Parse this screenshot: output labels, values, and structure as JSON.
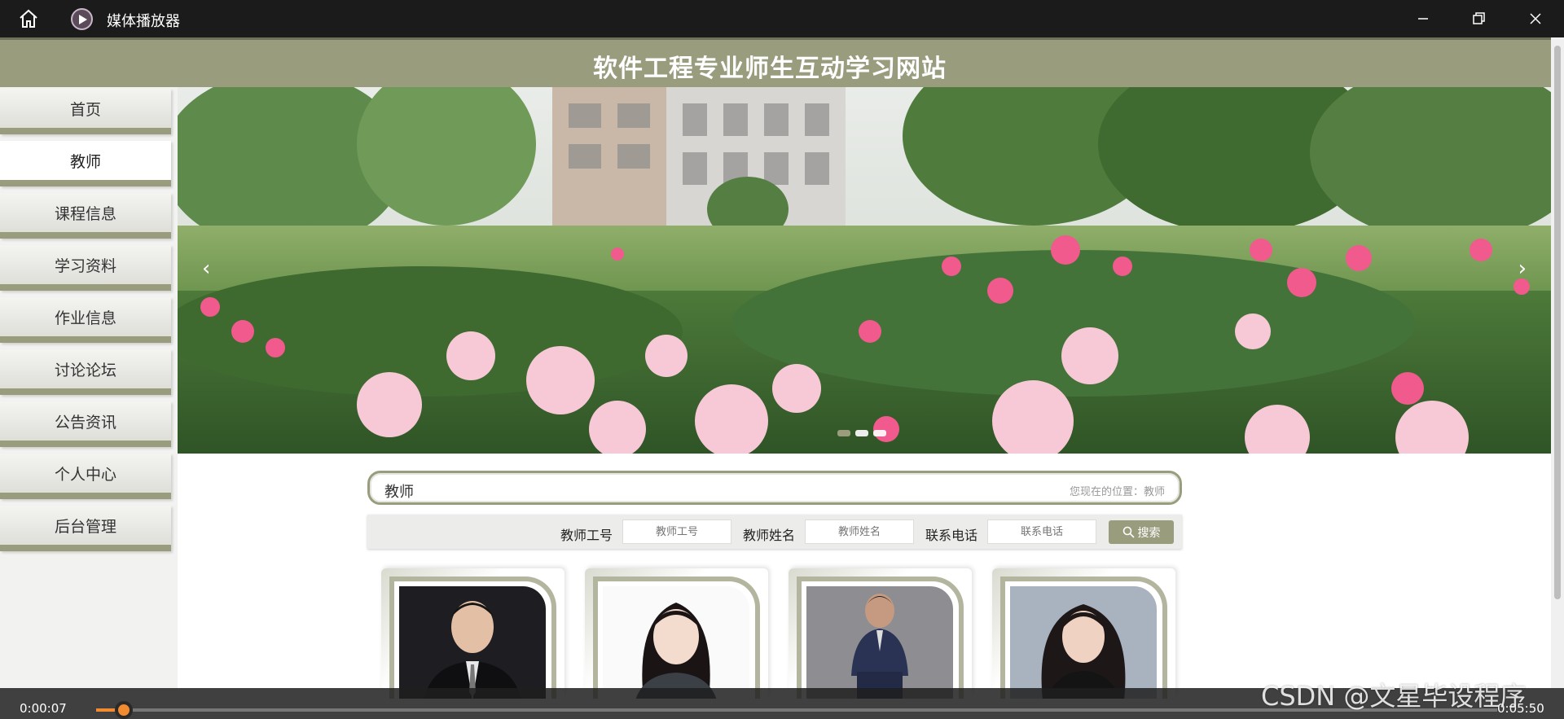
{
  "player": {
    "title": "媒体播放器",
    "current_time": "0:00:07",
    "total_time": "0:05:50",
    "progress": 0.02
  },
  "site": {
    "title": "软件工程专业师生互动学习网站"
  },
  "sidebar": {
    "items": [
      {
        "label": "首页"
      },
      {
        "label": "教师"
      },
      {
        "label": "课程信息"
      },
      {
        "label": "学习资料"
      },
      {
        "label": "作业信息"
      },
      {
        "label": "讨论论坛"
      },
      {
        "label": "公告资讯"
      },
      {
        "label": "个人中心"
      },
      {
        "label": "后台管理"
      }
    ],
    "active_index": 1
  },
  "banner": {
    "arrow_left": "‹",
    "arrow_right": "›",
    "slide_count": 3,
    "active_slide": 0
  },
  "breadcrumb": {
    "title": "教师",
    "location": "您现在的位置：教师"
  },
  "search": {
    "fields": [
      {
        "label": "教师工号",
        "placeholder": "教师工号"
      },
      {
        "label": "教师姓名",
        "placeholder": "教师姓名"
      },
      {
        "label": "联系电话",
        "placeholder": "联系电话"
      }
    ],
    "button_label": "搜索"
  },
  "watermark": "CSDN @文星毕设程序",
  "colors": {
    "accent": "#9a9c7e",
    "progress": "#f28a30",
    "titlebar": "#1b1b1b"
  }
}
